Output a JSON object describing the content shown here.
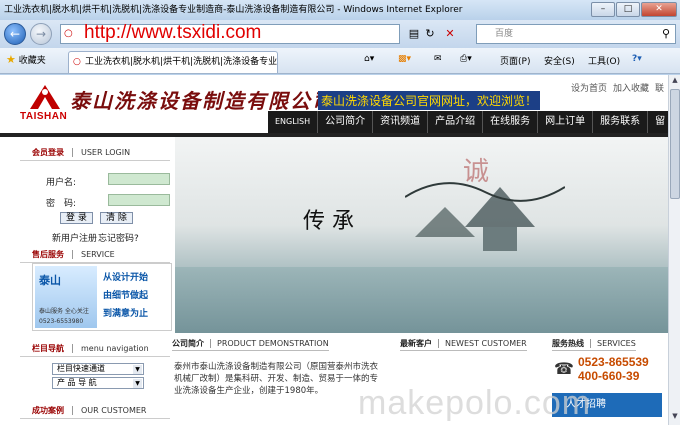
{
  "window": {
    "title": "工业洗衣机|脱水机|烘干机|洗脱机|洗涤设备专业制造商-泰山洗涤设备制造有限公司 - Windows Internet Explorer",
    "url_overlay": "http://www.tsxidi.com",
    "search_placeholder": "百度"
  },
  "favbar": {
    "favorites_label": "收藏夹",
    "tab_title": "工业洗衣机|脱水机|烘干机|洗脱机|洗涤设备专业...",
    "page_menu": "页面(P)",
    "safety_menu": "安全(S)",
    "tools_menu": "工具(O)"
  },
  "header": {
    "logo_en": "TAISHAN",
    "logo_cn": "泰山洗涤设备制造有限公司",
    "welcome": "泰山洗涤设备公司官网网址，欢迎浏览！",
    "toplinks": [
      "设为首页",
      "加入收藏",
      "联"
    ],
    "nav": [
      "ENGLISH",
      "公司简介",
      "资讯频道",
      "产品介绍",
      "在线服务",
      "网上订单",
      "服务联系",
      "留"
    ]
  },
  "login": {
    "title_cn": "会员登录",
    "title_en": "USER LOGIN",
    "username_label": "用户名:",
    "password_label": "密　码:",
    "login_btn": "登 录",
    "clear_btn": "清 除",
    "register": "新用户注册",
    "forgot": "忘记密码?"
  },
  "service": {
    "title_cn": "售后服务",
    "title_en": "SERVICE",
    "ad_brand": "泰山",
    "ad_sub1": "泰山服务  全心关注",
    "ad_sub2": "0523-6553980",
    "lines": [
      "从设计开始",
      "由细节做起",
      "到满意为止"
    ]
  },
  "column_nav": {
    "title_cn": "栏目导航",
    "title_en": "menu navigation",
    "select1": "栏目快速通道",
    "select2": "产 品 导 航"
  },
  "cases": {
    "title_cn": "成功案例",
    "title_en": "OUR CUSTOMER"
  },
  "company": {
    "title_cn": "公司简介",
    "title_en": "PRODUCT DEMONSTRATION",
    "text": "泰州市泰山洗涤设备制造有限公司（原国营泰州市洗衣机械厂改制）是集科研、开发、制造、贸易于一体的专业洗涤设备生产企业，创建于1980年。"
  },
  "customers": {
    "title_cn": "最新客户",
    "title_en": "NEWEST CUSTOMER"
  },
  "hotline": {
    "title_cn": "服务热线",
    "title_en": "SERVICES",
    "phone1": "0523-865539",
    "phone2": "400-660-39",
    "recruit": "人才招聘"
  },
  "banner": {
    "chuan": "传 承",
    "cheng": "诚"
  },
  "watermark": "makepolo.com",
  "colors": {
    "nav_bg": "#1a1a1a",
    "welcome_text": "#ffd800",
    "url_overlay": "#e00000",
    "logo_red": "#c00000"
  }
}
